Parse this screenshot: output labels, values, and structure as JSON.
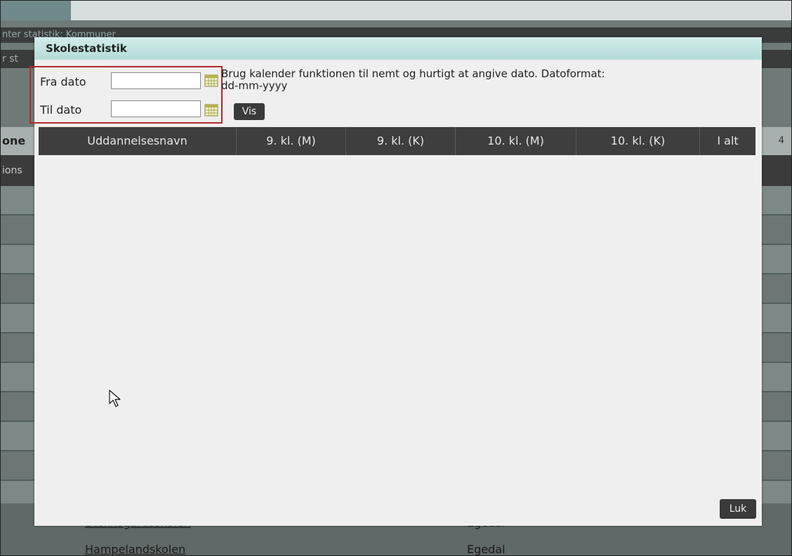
{
  "background": {
    "crumb_text": "nter statistik: Kommuner",
    "crumb2_text": "r st",
    "header_text": "one",
    "header_number": "4",
    "subheader_text": "ions",
    "list": [
      {
        "name": "Bækkegårdsskolen",
        "city": "Egedal"
      },
      {
        "name": "Hampelandskolen",
        "city": "Egedal"
      }
    ]
  },
  "modal": {
    "title": "Skolestatistik",
    "from_label": "Fra dato",
    "to_label": "Til dato",
    "from_value": "",
    "to_value": "",
    "hint_line1": "Brug kalender funktionen til nemt og hurtigt at angive dato. Datoformat:",
    "hint_line2": "dd-mm-yyyy",
    "show_button": "Vis",
    "close_button": "Luk",
    "table_headers": [
      "Uddannelsesnavn",
      "9. kl. (M)",
      "9. kl. (K)",
      "10. kl. (M)",
      "10. kl. (K)",
      "I alt"
    ]
  },
  "colors": {
    "highlight_border": "#b22a2a",
    "title_bar": "#b4dcd8",
    "header_bg": "#3e3e3e"
  },
  "icons": {
    "calendar": "calendar-icon",
    "cursor": "mouse-pointer-icon"
  }
}
